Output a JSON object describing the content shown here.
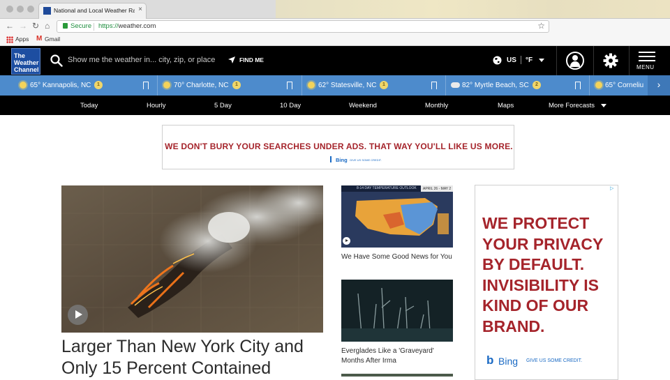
{
  "browser": {
    "tab_title": "National and Local Weather Ra",
    "tab_close": "×",
    "secure_label": "Secure",
    "url_scheme": "https://",
    "url_host": "weather.com",
    "bookmarks": [
      "Apps",
      "Gmail"
    ]
  },
  "header": {
    "logo_lines": [
      "The",
      "Weather",
      "Channel"
    ],
    "search_placeholder": "Show me the weather in... city, zip, or place",
    "find_me": "FIND ME",
    "region": "US",
    "unit": "°F",
    "menu_label": "MENU"
  },
  "locations": [
    {
      "temp_city": "65° Kannapolis, NC",
      "badge": "1",
      "icon": "sun-icon"
    },
    {
      "temp_city": "70° Charlotte, NC",
      "badge": "1",
      "icon": "sun-icon"
    },
    {
      "temp_city": "62° Statesville, NC",
      "badge": "1",
      "icon": "sun-icon"
    },
    {
      "temp_city": "82° Myrtle Beach, SC",
      "badge": "2",
      "icon": "cloud-icon"
    },
    {
      "temp_city": "65° Corneliu",
      "badge": "",
      "icon": "sun-icon"
    }
  ],
  "forecast_nav": [
    "Today",
    "Hourly",
    "5 Day",
    "10 Day",
    "Weekend",
    "Monthly",
    "Maps",
    "More Forecasts"
  ],
  "banner_ad": {
    "message": "WE DON'T BURY YOUR SEARCHES UNDER ADS. THAT WAY YOU'LL LIKE US MORE.",
    "brand": "Bing",
    "credit": "GIVE US SOME CREDIT."
  },
  "main_story": {
    "headline": "Larger Than New York City and Only 15 Percent Contained"
  },
  "side_stories": [
    {
      "caption": "We Have Some Good News for You",
      "thumb_header": "8-14 DAY TEMPERATURE OUTLOOK",
      "thumb_dates": "APRIL 26 - MAY 2"
    },
    {
      "caption": "Everglades Like a 'Graveyard' Months After Irma"
    }
  ],
  "side_ad": {
    "message": "WE PROTECT YOUR PRIVACY BY DEFAULT. INVISIBILITY IS KIND OF OUR BRAND.",
    "brand": "Bing",
    "credit": "GIVE US SOME CREDIT."
  },
  "colors": {
    "header_bg": "#000000",
    "logo_bg": "#1d4ea1",
    "locations_bg": "#4d8bcc",
    "ad_red": "#a5242b",
    "bing_blue": "#1a6ac4"
  }
}
